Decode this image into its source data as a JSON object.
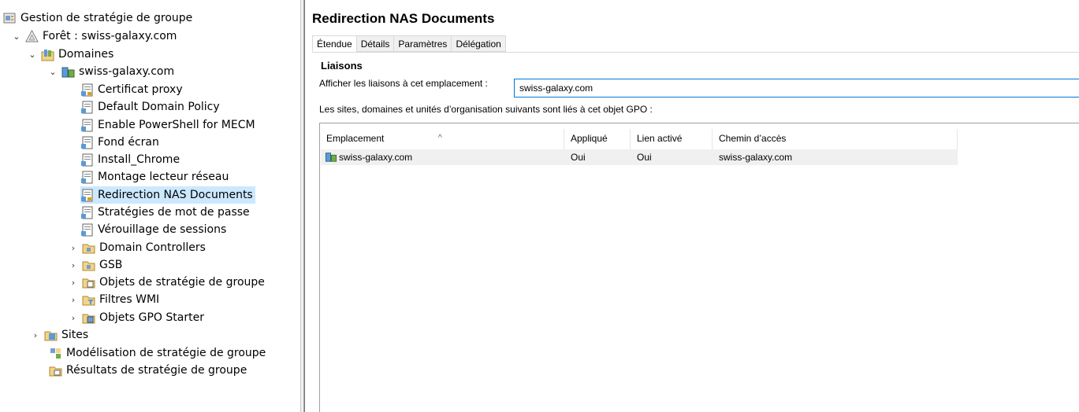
{
  "tree": {
    "root": "Gestion de stratégie de groupe",
    "forest": "Forêt : swiss-galaxy.com",
    "domains": "Domaines",
    "domain": "swiss-galaxy.com",
    "gpo_links": [
      "Certificat proxy",
      "Default Domain Policy",
      "Enable PowerShell for MECM",
      "Fond écran",
      "Install_Chrome",
      "Montage lecteur réseau",
      "Redirection NAS Documents",
      "Stratégies de mot de passe",
      "Vérouillage de sessions"
    ],
    "containers": [
      "Domain Controllers",
      "GSB",
      "Objets de stratégie de groupe",
      "Filtres WMI",
      "Objets GPO Starter"
    ],
    "sites": "Sites",
    "modeling": "Modélisation de stratégie de groupe",
    "results": "Résultats de stratégie de groupe"
  },
  "details": {
    "title": "Redirection NAS Documents",
    "tabs": [
      "Étendue",
      "Détails",
      "Paramètres",
      "Délégation"
    ],
    "section": "Liaisons",
    "show_label": "Afficher les liaisons à cet emplacement :",
    "show_value": "swiss-galaxy.com",
    "description": "Les sites, domaines et unités d’organisation suivants sont liés à cet objet GPO :",
    "columns": [
      "Emplacement",
      "Appliqué",
      "Lien activé",
      "Chemin d’accès"
    ],
    "rows": [
      [
        "swiss-galaxy.com",
        "Oui",
        "Oui",
        "swiss-galaxy.com"
      ]
    ]
  },
  "colors": {
    "selection": "#cce8ff",
    "input_border": "#0078d7"
  }
}
